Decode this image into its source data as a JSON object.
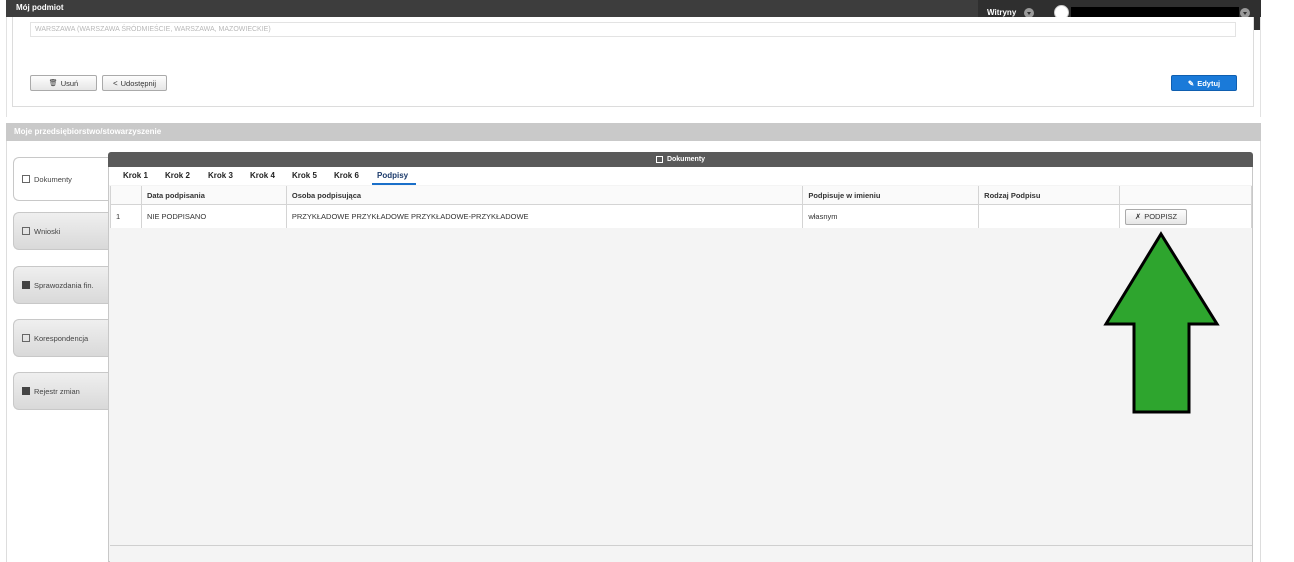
{
  "topbar": {
    "title": "Mój podmiot",
    "sites_label": "Witryny"
  },
  "entity": {
    "address_value": "WARSZAWA (WARSZAWA ŚRÓDMIEŚCIE, WARSZAWA, MAZOWIECKIE)",
    "delete_label": "Usuń",
    "share_label": "Udostępnij",
    "edit_label": "Edytuj"
  },
  "section": {
    "title": "Moje przedsiębiorstwo/stowarzyszenie"
  },
  "side_tabs": [
    {
      "label": "Dokumenty",
      "icon": "document-icon",
      "active": true
    },
    {
      "label": "Wnioski",
      "icon": "file-icon"
    },
    {
      "label": "Sprawozdania fin.",
      "icon": "folder-icon"
    },
    {
      "label": "Korespondencja",
      "icon": "envelope-icon"
    },
    {
      "label": "Rejestr zmian",
      "icon": "briefcase-icon"
    }
  ],
  "documents": {
    "title": "Dokumenty",
    "steps": [
      "Krok 1",
      "Krok 2",
      "Krok 3",
      "Krok 4",
      "Krok 5",
      "Krok 6",
      "Podpisy"
    ],
    "active_step": "Podpisy",
    "columns": [
      "",
      "Data podpisania",
      "Osoba podpisująca",
      "Podpisuje w imieniu",
      "Rodzaj Podpisu",
      ""
    ],
    "rows": [
      {
        "no": "1",
        "date": "NIE PODPISANO",
        "person": "PRZYKŁADOWE PRZYKŁADOWE PRZYKŁADOWE-PRZYKŁADOWE",
        "on_behalf": "własnym",
        "signature_type": "",
        "action_label": "PODPISZ"
      }
    ]
  },
  "annotation": {
    "arrow_color": "#2ea52e",
    "arrow_outline": "#000000"
  }
}
